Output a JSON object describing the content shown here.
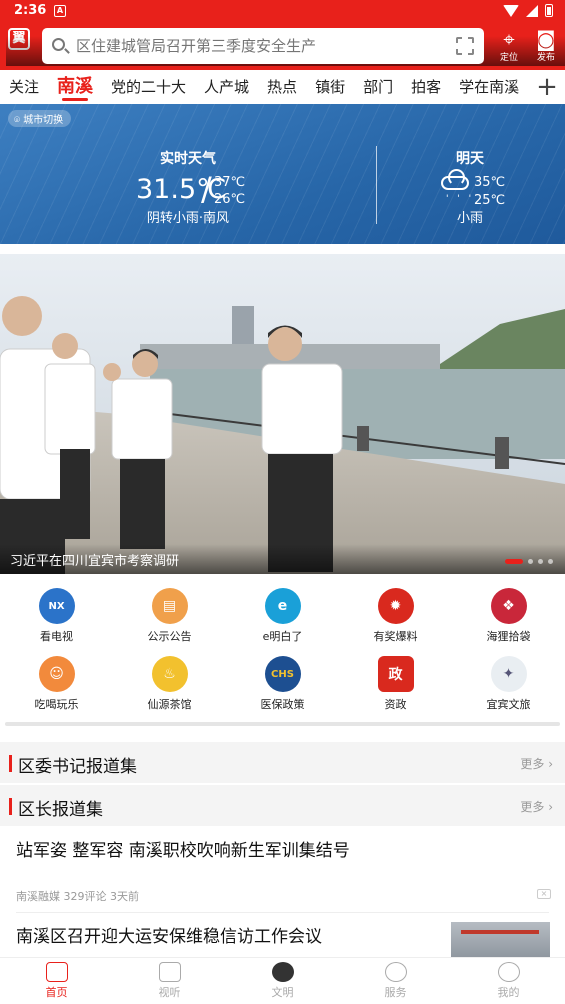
{
  "status_bar": {
    "time": "2:36",
    "notif_letter": "A"
  },
  "header": {
    "logo_glyph": "翼",
    "logo_label": "翼聚",
    "search_placeholder": "区住建城管局召开第三季度安全生产",
    "location_label": "定位",
    "publish_label": "发布"
  },
  "tabs": [
    {
      "label": "关注",
      "active": false
    },
    {
      "label": "南溪",
      "active": true
    },
    {
      "label": "党的二十大",
      "active": false
    },
    {
      "label": "人产城",
      "active": false
    },
    {
      "label": "热点",
      "active": false
    },
    {
      "label": "镇街",
      "active": false
    },
    {
      "label": "部门",
      "active": false
    },
    {
      "label": "拍客",
      "active": false
    },
    {
      "label": "学在南溪",
      "active": false
    }
  ],
  "weather": {
    "city_switch": "城市切换",
    "now_title": "实时天气",
    "now_temp": "31.5℃",
    "now_high": "37℃",
    "now_low": "26℃",
    "now_desc": "阴转小雨·南风",
    "tomorrow_title": "明天",
    "tomorrow_high": "35℃",
    "tomorrow_low": "25℃",
    "tomorrow_desc": "小雨"
  },
  "banner": {
    "caption": "习近平在四川宜宾市考察调研",
    "slide_count": 4,
    "active_slide": 0
  },
  "services": [
    {
      "label": "看电视",
      "icon": "tv-icon",
      "color": "#2b73c9",
      "glyph": "NX"
    },
    {
      "label": "公示公告",
      "icon": "notice-icon",
      "color": "#f0a04b",
      "glyph": "▤"
    },
    {
      "label": "e明白了",
      "icon": "e-icon",
      "color": "#1aa0d8",
      "glyph": "e"
    },
    {
      "label": "有奖爆料",
      "icon": "fire-icon",
      "color": "#d9291e",
      "glyph": "✹"
    },
    {
      "label": "海狸拾袋",
      "icon": "gift-icon",
      "color": "#c9273a",
      "glyph": "❖"
    },
    {
      "label": "吃喝玩乐",
      "icon": "food-icon",
      "color": "#f28a3c",
      "glyph": "☺"
    },
    {
      "label": "仙源茶馆",
      "icon": "teapot-icon",
      "color": "#f2c12e",
      "glyph": "♨"
    },
    {
      "label": "医保政策",
      "icon": "chs-icon",
      "color": "#1d4f91",
      "glyph": "CHS"
    },
    {
      "label": "资政",
      "icon": "gov-icon",
      "color": "#d9291e",
      "glyph": "政"
    },
    {
      "label": "宜宾文旅",
      "icon": "travel-icon",
      "color": "#e9eef2",
      "glyph": "✦"
    }
  ],
  "sections": [
    {
      "title": "区委书记报道集",
      "more": "更多"
    },
    {
      "title": "区长报道集",
      "more": "更多"
    }
  ],
  "news": [
    {
      "title": "站军姿 整军容 南溪职校吹响新生军训集结号",
      "meta": "南溪融媒 329评论 3天前"
    },
    {
      "title": "南溪区召开迎大运安保维稳信访工作会议"
    }
  ],
  "bottom_nav": [
    {
      "label": "首页",
      "active": true
    },
    {
      "label": "视听",
      "active": false
    },
    {
      "label": "文明",
      "active": false
    },
    {
      "label": "服务",
      "active": false
    },
    {
      "label": "我的",
      "active": false
    }
  ],
  "colors": {
    "brand": "#e8211b",
    "weather_bg": "#2766a8"
  }
}
